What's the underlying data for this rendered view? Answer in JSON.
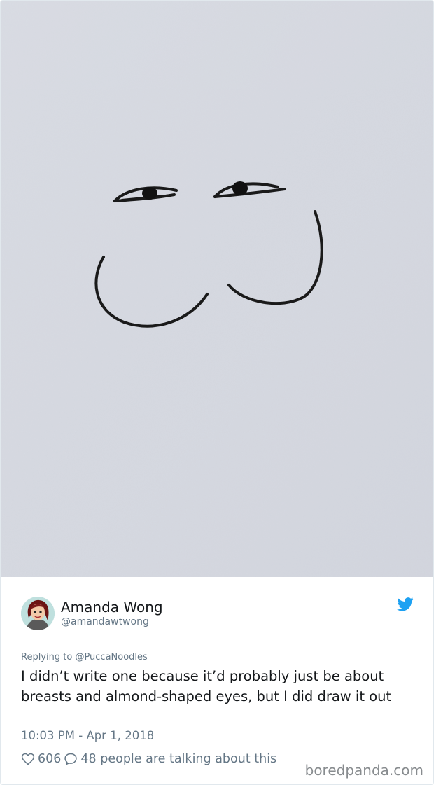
{
  "author": {
    "name": "Amanda Wong",
    "handle": "@amandawtwong"
  },
  "reply": {
    "prefix": "Replying to",
    "handle": "@PuccaNoodles"
  },
  "tweet": {
    "text": "I didn’t write one because it’d probably just be about breasts and almond-shaped eyes, but I did draw it out",
    "timestamp": "10:03 PM - Apr 1, 2018"
  },
  "engagement": {
    "likes": "606",
    "talking": "48 people are talking about this"
  },
  "watermark": "boredpanda.com",
  "icons": {
    "platform": "twitter-bird-icon",
    "like": "heart-icon",
    "reply": "speech-bubble-icon"
  },
  "colors": {
    "twitter_blue": "#1da1f2",
    "secondary_text": "#657786",
    "paper": "#d8dbe3",
    "ink": "#1a1a1a"
  }
}
